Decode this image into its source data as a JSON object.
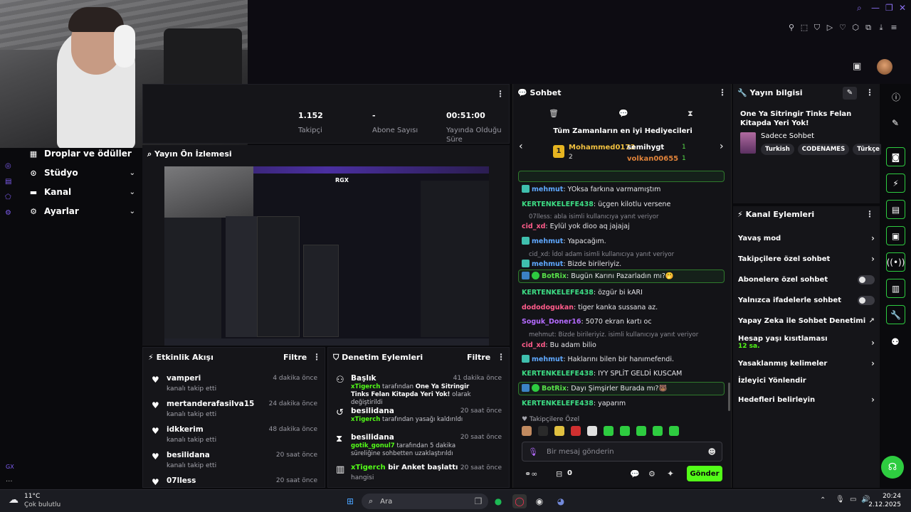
{
  "stats": {
    "followers_value": "1.152",
    "followers_label": "Takipçi",
    "subs_value": "-",
    "subs_label": "Abone Sayısı",
    "uptime_value": "00:51:00",
    "uptime_label": "Yayında Olduğu Süre"
  },
  "nav": {
    "drops": "Droplar ve ödüller",
    "studio": "Stüdyo",
    "channel": "Kanal",
    "settings": "Ayarlar",
    "gx": "GX"
  },
  "preview": {
    "title": "Yayın Ön İzlemesi",
    "overlay": "RGX"
  },
  "activity": {
    "title": "Etkinlik Akışı",
    "filter": "Filtre",
    "items": [
      {
        "name": "vamperi",
        "sub": "kanalı takip etti",
        "time": "4 dakika önce"
      },
      {
        "name": "mertanderafasilva15",
        "sub": "kanalı takip etti",
        "time": "24 dakika önce"
      },
      {
        "name": "idkkerim",
        "sub": "kanalı takip etti",
        "time": "48 dakika önce"
      },
      {
        "name": "besilidana",
        "sub": "kanalı takip etti",
        "time": "20 saat önce"
      },
      {
        "name": "07lless",
        "sub": "",
        "time": "20 saat önce"
      }
    ]
  },
  "moderation": {
    "title": "Denetim Eylemleri",
    "filter": "Filtre",
    "items": [
      {
        "name": "Başlık",
        "user": "xTigerch",
        "mid": "tarafından",
        "bold": "One Ya Sitringir Tinks Felan Kitapda Yeri Yok!",
        "tail": "olarak değiştirildi",
        "time": "41 dakika önce"
      },
      {
        "name": "besilidana",
        "user": "xTigerch",
        "mid": "tarafından yasağı kaldırıldı",
        "bold": "",
        "tail": "",
        "time": "20 saat önce"
      },
      {
        "name": "besilidana",
        "user": "gotik_gonul7",
        "mid": "tarafından 5 dakika süreliğine sohbetten uzaklaştırıldı",
        "bold": "",
        "tail": "",
        "time": "20 saat önce"
      },
      {
        "name": "xTigerch",
        "user": "",
        "mid": "",
        "bold": "",
        "tail": "",
        "time": "20 saat önce",
        "poll": "bir Anket başlattı",
        "poll_sub": "hangisi"
      }
    ]
  },
  "chat": {
    "title": "Sohbet",
    "gifters_title": "Tüm Zamanların en iyi Hediyecileri",
    "gifters": [
      {
        "name": "Mohammed0173",
        "count": "2"
      },
      {
        "name": "semihygt",
        "count": "1"
      },
      {
        "name": "volkan00655",
        "count": "1"
      }
    ],
    "messages": [
      {
        "user": "mehmut",
        "text": ": YOksa farkına varmamıştım",
        "color": "#5fa8ff"
      },
      {
        "user": "KERTENKELEFE438",
        "text": ": üçgen kilotlu versene",
        "color": "#3ddc84"
      },
      {
        "reply": "07lless: abla isimli kullanıcıya yanıt veriyor"
      },
      {
        "user": "cid_xd",
        "text": ": Eylül yok dioo aq jajajaj",
        "color": "#ff5c8a"
      },
      {
        "user": "mehmut",
        "text": ": Yapacağım.",
        "color": "#5fa8ff"
      },
      {
        "reply": "cid_xd: İdol adam isimli kullanıcıya yanıt veriyor"
      },
      {
        "user": "mehmut",
        "text": ": Bizde birileriyiz.",
        "color": "#5fa8ff"
      },
      {
        "user": "BotRix",
        "text": ": Bugün Karını Pazarladın mı?🤭",
        "color": "#58e04a",
        "box": true
      },
      {
        "user": "KERTENKELEFE438",
        "text": ": özgür bi kARI",
        "color": "#3ddc84"
      },
      {
        "user": "dododogukan",
        "text": ": tiger kanka sussana az.",
        "color": "#ff5c8a"
      },
      {
        "user": "Soguk_Doner16",
        "text": ": 5070 ekran kartı oc",
        "color": "#b46bff"
      },
      {
        "reply": "mehmut: Bizde birileriyiz. isimli kullanıcıya yanıt veriyor"
      },
      {
        "user": "cid_xd",
        "text": ": Bu adam bilio",
        "color": "#ff5c8a"
      },
      {
        "user": "mehmut",
        "text": ": Haklarını bilen bir hanımefendi.",
        "color": "#5fa8ff"
      },
      {
        "user": "KERTENKELEFE438",
        "text": ": IYY SPLİT GELDİ KUSCAM",
        "color": "#3ddc84"
      },
      {
        "user": "BotRix",
        "text": ": Dayı Şimşirler Burada mı?🐻",
        "color": "#58e04a",
        "box": true
      },
      {
        "user": "KERTENKELEFE438",
        "text": ": yaparım",
        "color": "#3ddc84"
      }
    ],
    "emote_label": "Takipçilere Özel",
    "input_placeholder": "Bir mesaj gönderin",
    "points": "0",
    "send": "Gönder"
  },
  "info": {
    "title": "Yayın bilgisi",
    "stream_title": "One Ya Sitringir Tinks Felan Kitapda Yeri Yok!",
    "category": "Sadece Sohbet",
    "tags": [
      "Turkish",
      "CODENAMES",
      "Türkçe"
    ]
  },
  "actions": {
    "title": "Kanal Eylemleri",
    "slow": "Yavaş mod",
    "followers_only": "Takipçilere özel sohbet",
    "subs_only": "Abonelere özel sohbet",
    "emote_only": "Yalnızca ifadelerle sohbet",
    "ai_mod": "Yapay Zeka ile Sohbet Denetimi",
    "age": "Hesap yaşı kısıtlaması",
    "age_val": "12 sa.",
    "banned_words": "Yasaklanmış kelimeler",
    "redirect": "İzleyici Yönlendir",
    "goals": "Hedefleri belirleyin"
  },
  "taskbar": {
    "temp": "11°C",
    "weather": "Çok bulutlu",
    "search": "Ara",
    "time": "20:24",
    "date": "2.12.2025"
  }
}
